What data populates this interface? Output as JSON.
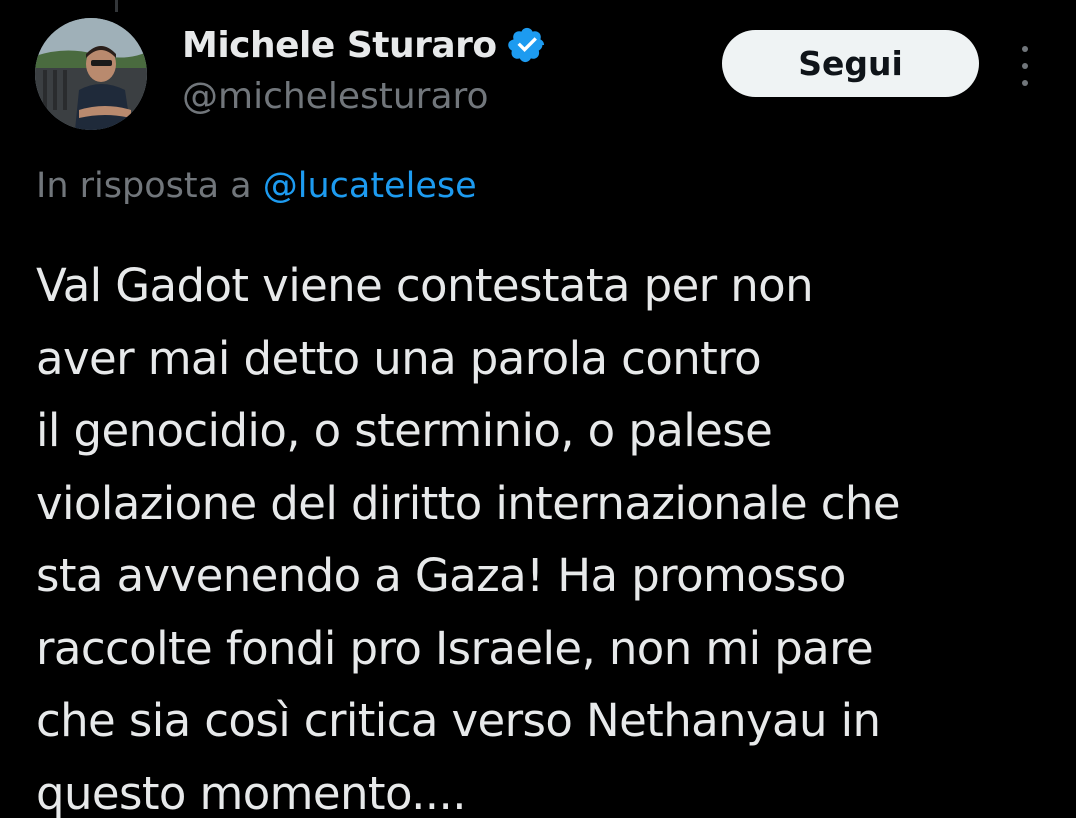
{
  "author": {
    "display_name": "Michele Sturaro",
    "handle": "@michelesturaro",
    "verified": true
  },
  "actions": {
    "follow_label": "Segui",
    "more_icon": "more-vertical-icon"
  },
  "reply": {
    "prefix": "In risposta a",
    "mention": "@lucatelese"
  },
  "tweet": {
    "lines": [
      "Val Gadot viene contestata per non",
      "aver mai detto una parola contro",
      "il genocidio, o sterminio, o palese",
      "violazione del diritto internazionale che",
      "sta avvenendo a Gaza! Ha promosso",
      "raccolte fondi pro Israele, non mi pare",
      "che sia così critica verso Nethanyau in",
      "questo momento...."
    ]
  },
  "colors": {
    "background": "#000000",
    "text_primary": "#e7e9ea",
    "text_secondary": "#71767b",
    "accent": "#1d9bf0",
    "button_bg": "#eff3f4"
  }
}
